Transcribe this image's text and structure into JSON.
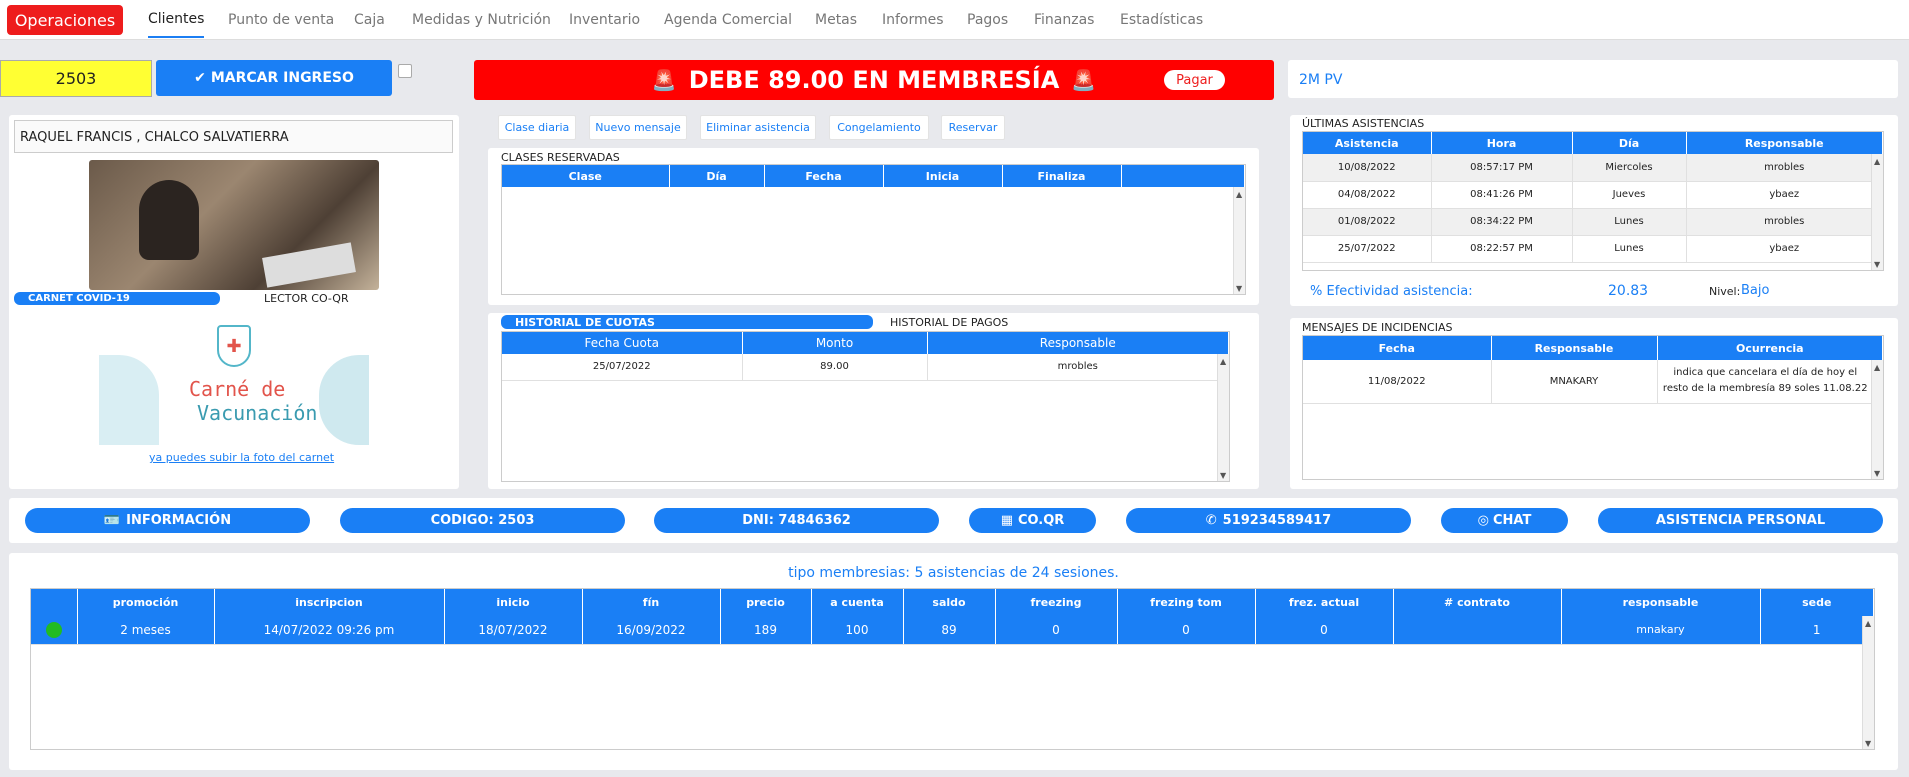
{
  "nav": {
    "brand": "Operaciones",
    "items": [
      "Clientes",
      "Punto de venta",
      "Caja",
      "Medidas y Nutrición",
      "Inventario",
      "Agenda Comercial",
      "Metas",
      "Informes",
      "Pagos",
      "Finanzas",
      "Estadísticas"
    ]
  },
  "checkin": {
    "code_value": "2503",
    "mark_button": "MARCAR INGRESO",
    "check_icon": "check-icon"
  },
  "debt": {
    "message": "DEBE 89.00 EN MEMBRESÍA",
    "pay_button": "Pagar",
    "alarm_icon": "alarm-light-icon"
  },
  "plan_label": "2M PV",
  "client": {
    "name": "RAQUEL FRANCIS , CHALCO SALVATIERRA",
    "tab_covid": "CARNET COVID-19",
    "tab_qr": "LECTOR CO-QR",
    "vacuna_line1": "Carné de",
    "vacuna_line2": "Vacunación",
    "upload_link": "ya puedes subir la foto del carnet"
  },
  "actions": [
    "Clase diaria",
    "Nuevo mensaje",
    "Eliminar asistencia",
    "Congelamiento",
    "Reservar"
  ],
  "reserved": {
    "title": "CLASES RESERVADAS",
    "headers": [
      "Clase",
      "Día",
      "Fecha",
      "Inicia",
      "Finaliza",
      ""
    ]
  },
  "cuotas": {
    "tab_active": "HISTORIAL DE CUOTAS",
    "tab_other": "HISTORIAL DE PAGOS",
    "headers": [
      "Fecha Cuota",
      "Monto",
      "Responsable"
    ],
    "rows": [
      [
        "25/07/2022",
        "89.00",
        "mrobles"
      ]
    ]
  },
  "attendance": {
    "title": "ÚLTIMAS ASISTENCIAS",
    "headers": [
      "Asistencia",
      "Hora",
      "Día",
      "Responsable"
    ],
    "rows": [
      [
        "10/08/2022",
        "08:57:17 PM",
        "Miercoles",
        "mrobles"
      ],
      [
        "04/08/2022",
        "08:41:26 PM",
        "Jueves",
        "ybaez"
      ],
      [
        "01/08/2022",
        "08:34:22 PM",
        "Lunes",
        "mrobles"
      ],
      [
        "25/07/2022",
        "08:22:57 PM",
        "Lunes",
        "ybaez"
      ]
    ],
    "efectividad_label": "% Efectividad asistencia:",
    "efectividad_value": "20.83",
    "nivel_label": "Nivel:",
    "nivel_value": "Bajo"
  },
  "incidents": {
    "title": "MENSAJES DE INCIDENCIAS",
    "headers": [
      "Fecha",
      "Responsable",
      "Ocurrencia"
    ],
    "rows": [
      [
        "11/08/2022",
        "MNAKARY",
        "indica que cancelara el día de hoy el resto de la membresía 89 soles 11.08.22"
      ]
    ]
  },
  "info_bar": {
    "informacion": "INFORMACIÓN",
    "codigo": "CODIGO: 2503",
    "dni": "DNI: 74846362",
    "coqr": "CO.QR",
    "phone": "519234589417",
    "chat": "CHAT",
    "asistencia": "ASISTENCIA PERSONAL"
  },
  "membership": {
    "summary": "tipo membresias: 5 asistencias de 24 sesiones.",
    "headers": [
      "",
      "promoción",
      "inscripcion",
      "inicio",
      "fín",
      "precio",
      "a cuenta",
      "saldo",
      "freezing",
      "frezing tom",
      "frez. actual",
      "# contrato",
      "responsable",
      "sede"
    ],
    "rows": [
      [
        "",
        "2 meses",
        "14/07/2022 09:26 pm",
        "18/07/2022",
        "16/09/2022",
        "189",
        "100",
        "89",
        "0",
        "0",
        "0",
        "",
        "mnakary",
        "1"
      ]
    ],
    "status_color": "#22bb22"
  },
  "colors": {
    "accent": "#1a7ff5",
    "danger": "#ff0000",
    "highlight": "#ffff33"
  }
}
